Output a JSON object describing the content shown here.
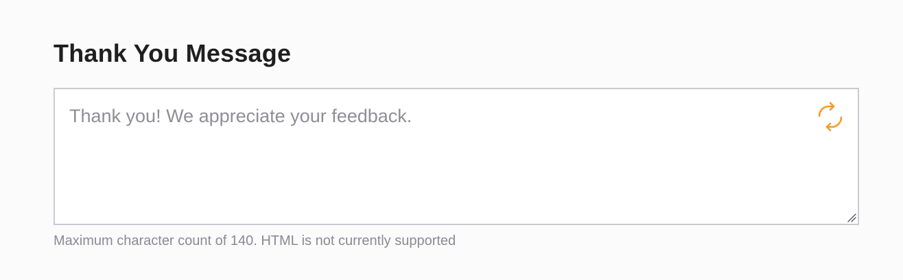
{
  "thank_you": {
    "title": "Thank You Message",
    "textarea": {
      "value": "",
      "placeholder": "Thank you! We appreciate your feedback."
    },
    "refresh_icon": "refresh-icon",
    "hint": "Maximum character count of 140. HTML is not currently supported"
  },
  "colors": {
    "accent": "#f39a2b",
    "border": "#c9cad3",
    "title": "#1f1f1f",
    "muted": "#8a8a92"
  }
}
